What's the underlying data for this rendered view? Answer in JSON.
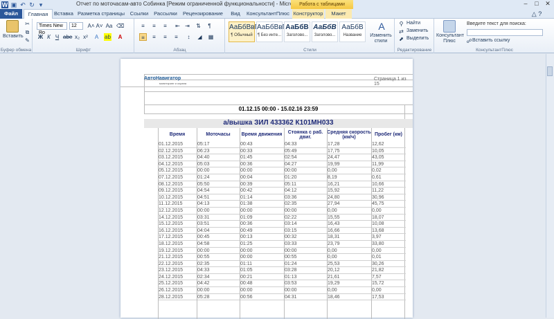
{
  "window": {
    "title": "Отчет по моточасам-авто Собинка [Режим ограниченной функциональности] - Microsoft Word",
    "context_title": "Работа с таблицами"
  },
  "tabs": [
    "Файл",
    "Главная",
    "Вставка",
    "Разметка страницы",
    "Ссылки",
    "Рассылки",
    "Рецензирование",
    "Вид",
    "КонсультантПлюс",
    "Конструктор",
    "Макет"
  ],
  "ribbon": {
    "clipboard": {
      "paste": "Вставить",
      "group": "Буфер обмена"
    },
    "font": {
      "name": "Times New Ro",
      "size": "12",
      "group": "Шрифт"
    },
    "paragraph": {
      "group": "Абзац"
    },
    "styles": {
      "items": [
        {
          "preview": "АаБбВвГг",
          "name": "¶ Обычный"
        },
        {
          "preview": "АаБбВвГг",
          "name": "¶ Без инте..."
        },
        {
          "preview": "АаБбВ",
          "name": "Заголово..."
        },
        {
          "preview": "АаБбВ",
          "name": "Заголово..."
        },
        {
          "preview": "АаБбВ",
          "name": "Название"
        }
      ],
      "change": "Изменить стили",
      "group": "Стили"
    },
    "editing": {
      "find": "Найти",
      "replace": "Заменить",
      "select": "Выделить",
      "group": "Редактирование"
    },
    "consultant": {
      "label": "Консультант Плюс",
      "search_label": "Введите текст для поиска:",
      "send": "Вставить ссылку",
      "group": "КонсультантПлюс"
    }
  },
  "document": {
    "logo": "АвтоНавигатор",
    "logo_sub": "мониторинг и охрана",
    "page_num": "Страница 1 из 15",
    "period": "01.12.15 00:00 - 15.02.16 23:59",
    "vehicle": "а/вышка ЗИЛ 433362 К101МН033",
    "headers": [
      "Время",
      "Моточасы",
      "Время движения",
      "Стоянка с раб. двиг.",
      "Средняя скорость (км/ч)",
      "Пробег (км)"
    ],
    "rows": [
      [
        "01.12.2015",
        "05:17",
        "00:43",
        "04:33",
        "17,28",
        "12,62"
      ],
      [
        "02.12.2015",
        "06:23",
        "00:33",
        "05:49",
        "17,75",
        "10,05"
      ],
      [
        "03.12.2015",
        "04:40",
        "01:45",
        "02:54",
        "24,47",
        "43,05"
      ],
      [
        "04.12.2015",
        "05:03",
        "00:36",
        "04:27",
        "19,99",
        "11,99"
      ],
      [
        "05.12.2015",
        "00:00",
        "00:00",
        "00:00",
        "0,00",
        "0,02"
      ],
      [
        "07.12.2015",
        "01:24",
        "00:04",
        "01:20",
        "8,19",
        "0,61"
      ],
      [
        "08.12.2015",
        "05:50",
        "00:39",
        "05:11",
        "16,21",
        "10,66"
      ],
      [
        "09.12.2015",
        "04:54",
        "00:42",
        "04:12",
        "15,92",
        "11,22"
      ],
      [
        "10.12.2015",
        "04:51",
        "01:14",
        "03:36",
        "24,80",
        "30,96"
      ],
      [
        "11.12.2015",
        "04:13",
        "01:38",
        "02:35",
        "27,94",
        "45,75"
      ],
      [
        "12.12.2015",
        "00:00",
        "00:00",
        "00:00",
        "0,00",
        "0,00"
      ],
      [
        "14.12.2015",
        "03:31",
        "01:09",
        "02:22",
        "15,55",
        "18,07"
      ],
      [
        "15.12.2015",
        "03:51",
        "00:36",
        "03:14",
        "16,43",
        "10,08"
      ],
      [
        "16.12.2015",
        "04:04",
        "00:49",
        "03:15",
        "16,66",
        "13,68"
      ],
      [
        "17.12.2015",
        "00:45",
        "00:13",
        "00:32",
        "18,31",
        "3,97"
      ],
      [
        "18.12.2015",
        "04:58",
        "01:25",
        "03:33",
        "23,79",
        "33,80"
      ],
      [
        "19.12.2015",
        "00:00",
        "00:00",
        "00:00",
        "0,00",
        "0,00"
      ],
      [
        "21.12.2015",
        "00:55",
        "00:00",
        "00:55",
        "0,00",
        "0,01"
      ],
      [
        "22.12.2015",
        "02:35",
        "01:11",
        "01:24",
        "25,53",
        "30,26"
      ],
      [
        "23.12.2015",
        "04:33",
        "01:05",
        "03:28",
        "20,12",
        "21,82"
      ],
      [
        "24.12.2015",
        "02:34",
        "00:21",
        "01:13",
        "21,61",
        "7,57"
      ],
      [
        "25.12.2015",
        "04:42",
        "00:48",
        "03:53",
        "19,29",
        "15,72"
      ],
      [
        "26.12.2015",
        "00:00",
        "00:00",
        "00:00",
        "0,00",
        "0,00"
      ],
      [
        "28.12.2015",
        "05:28",
        "00:56",
        "04:31",
        "18,46",
        "17,53"
      ]
    ]
  }
}
